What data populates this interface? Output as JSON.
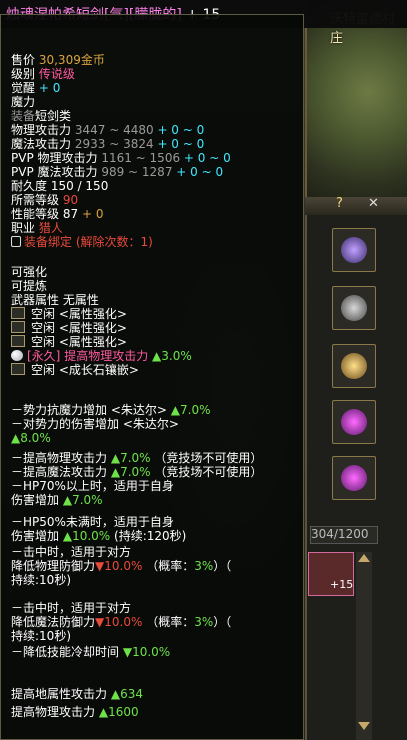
{
  "map": {
    "location": "沃特雷德村庄"
  },
  "panel": {
    "help": "?",
    "close": "✕",
    "counter": "304/1200",
    "item_count": "+15"
  },
  "title": {
    "name": "烛魂涅帕希短剑[气][朦胧的]",
    "enhance": "+ 15"
  },
  "stats": [
    {
      "label": "售价",
      "value": "30,309",
      "unit": "金币"
    },
    {
      "label": "级别",
      "value": "传说级"
    },
    {
      "label": "觉醒",
      "value": "+ 0"
    },
    {
      "label": "魔力",
      "value": ""
    },
    {
      "label": "装备",
      "value": "短剑类"
    },
    {
      "label": "物理攻击力",
      "range": "3447 ~ 4480",
      "bonus": "+ 0 ~ 0"
    },
    {
      "label": "魔法攻击力",
      "range": "2933 ~ 3824",
      "bonus": "+ 0 ~ 0"
    },
    {
      "label": "PVP 物理攻击力",
      "range": "1161 ~ 1506",
      "bonus": "+ 0 ~ 0"
    },
    {
      "label": "PVP 魔法攻击力",
      "range": "989 ~ 1287",
      "bonus": "+ 0 ~ 0"
    },
    {
      "label": "耐久度",
      "value": "150 / 150"
    },
    {
      "label": "所需等级",
      "value": "90"
    },
    {
      "label": "性能等级",
      "value": "87",
      "bonus": "+ 0"
    },
    {
      "label": "职业",
      "value": "猎人"
    }
  ],
  "bind": "装备绑定 (解除次数：1)",
  "enhance_title": "可强化",
  "refine_title": "可提炼",
  "weapon_attr": {
    "label": "武器属性",
    "value": "无属性"
  },
  "slots": [
    "空闲 <属性强化>",
    "空闲 <属性强化>",
    "空闲 <属性强化>"
  ],
  "perm": {
    "tag": "[永久]",
    "text": "提高物理攻击力",
    "value": "▲3.0%"
  },
  "growth_slot": "空闲 <成长石镶嵌>",
  "effects": {
    "e1a": "－势力抗魔力增加 <朱达尔>",
    "e1v": "▲7.0%",
    "e2a": "－对势力的伤害增加 <朱达尔>",
    "e2v": "▲8.0%",
    "e3a": "－提高物理攻击力",
    "e3v": "▲7.0%",
    "e3n": "（竞技场不可使用）",
    "e4a": "－提高魔法攻击力",
    "e4v": "▲7.0%",
    "e4n": "（竞技场不可使用）",
    "e5a": "－HP70%以上时，适用于自身",
    "e5b": "伤害增加",
    "e5v": "▲7.0%",
    "e6a": "－HP50%未满时，适用于自身",
    "e6b": "伤害增加",
    "e6v": "▲10.0%",
    "e6c": "(持续:120秒)",
    "e7a": "－击中时，适用于对方",
    "e7b": "降低物理防御力",
    "e7v": "▼10.0%",
    "e7c": "（概率：",
    "e7p": "3%",
    "e7d": "）（",
    "e7e": "持续:10秒)",
    "e8a": "－击中时，适用于对方",
    "e8b": "降低魔法防御力",
    "e8v": "▼10.0%",
    "e8c": "（概率：",
    "e8p": "3%",
    "e8d": "）（",
    "e8e": "持续:10秒)",
    "e9a": "－降低技能冷却时间",
    "e9v": "▼10.0%",
    "e10a": "提高地属性攻击力",
    "e10v": "▲634",
    "e11a": "提高物理攻击力",
    "e11v": "▲1600"
  },
  "colors": {
    "title": "#ff82ea",
    "green": "#6fe24a",
    "red": "#e94a3a",
    "cyan": "#40e8ff",
    "gold": "#d9a441"
  }
}
